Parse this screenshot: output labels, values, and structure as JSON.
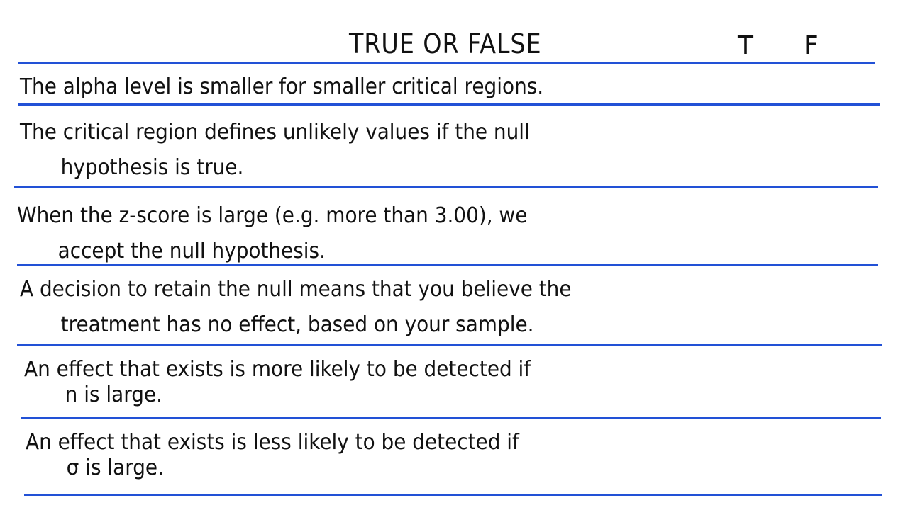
{
  "worksheet": {
    "title": "TRUE OR FALSE",
    "column_true": "T",
    "column_false": "F",
    "statements": [
      {
        "line1": "The alpha level is smaller for smaller critical regions.",
        "line2": ""
      },
      {
        "line1": "The critical region defines unlikely values if the null",
        "line2": "hypothesis is true."
      },
      {
        "line1": "When the z-score is large (e.g. more than 3.00), we",
        "line2": "accept the null hypothesis."
      },
      {
        "line1": "A decision to retain the null means that you believe the",
        "line2": "treatment has no effect, based on your sample."
      },
      {
        "line1": "An effect that exists is more likely to be detected if",
        "line2": "n is large."
      },
      {
        "line1": "An effect that exists is less likely to be detected if",
        "line2": "σ is large."
      }
    ]
  },
  "colors": {
    "rule_line": "#2251d6",
    "ink": "#111111"
  }
}
